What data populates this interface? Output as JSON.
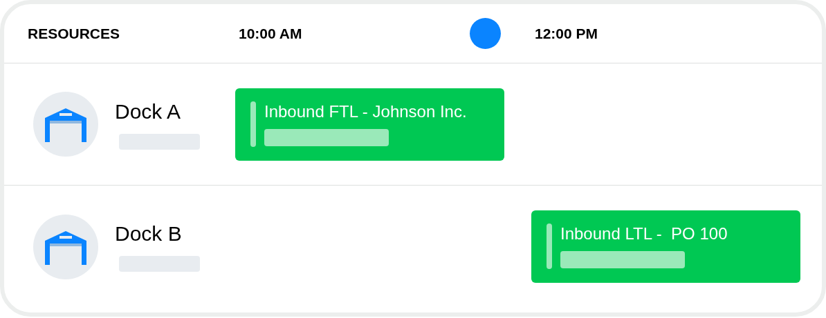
{
  "header": {
    "title": "RESOURCES",
    "time_slots": [
      "10:00 AM",
      "12:00 PM"
    ]
  },
  "resources": [
    {
      "name": "Dock A",
      "event": {
        "title": "Inbound FTL - Johnson Inc.",
        "kind": "first"
      }
    },
    {
      "name": "Dock B",
      "event": {
        "title": "Inbound LTL -  PO 100",
        "kind": "second"
      }
    }
  ]
}
